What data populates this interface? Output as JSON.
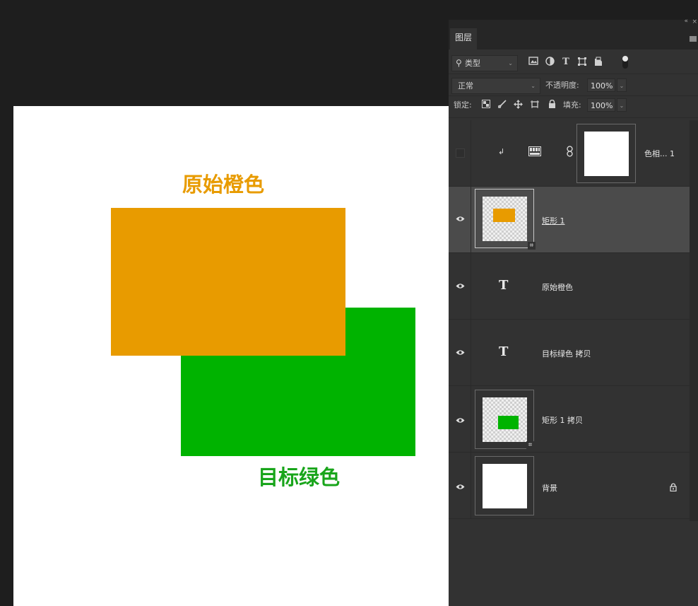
{
  "canvas": {
    "label_orange": "原始橙色",
    "label_green": "目标绿色",
    "orange_color": "#e89b00",
    "green_color": "#00b300",
    "orange_text_color": "#e89b00",
    "green_text_color": "#19a51b"
  },
  "panel": {
    "collapse_icon": "«",
    "close_icon": "×",
    "tab_label": "图层",
    "filter": {
      "search_icon": "⚲",
      "label": "类型",
      "dropdown_icon": "⌄",
      "icons": [
        "image-filter-icon",
        "adjustment-filter-icon",
        "type-filter-icon",
        "shape-filter-icon",
        "smart-object-filter-icon",
        "filter-toggle-icon"
      ]
    },
    "blend": {
      "mode": "正常",
      "opacity_label": "不透明度:",
      "opacity_value": "100%"
    },
    "lock": {
      "label": "锁定:",
      "fill_label": "填充:",
      "fill_value": "100%"
    },
    "layers": [
      {
        "name": "色相... 1",
        "type": "adjustment",
        "visible": false
      },
      {
        "name": "矩形 1",
        "type": "shape",
        "visible": true,
        "selected": true
      },
      {
        "name": "原始橙色",
        "type": "text",
        "visible": true,
        "icon_label": "T"
      },
      {
        "name": "目标绿色 拷贝",
        "type": "text",
        "visible": true,
        "icon_label": "T"
      },
      {
        "name": "矩形 1 拷贝",
        "type": "shape",
        "visible": true
      },
      {
        "name": "背景",
        "type": "background",
        "visible": true,
        "locked": true
      }
    ]
  }
}
